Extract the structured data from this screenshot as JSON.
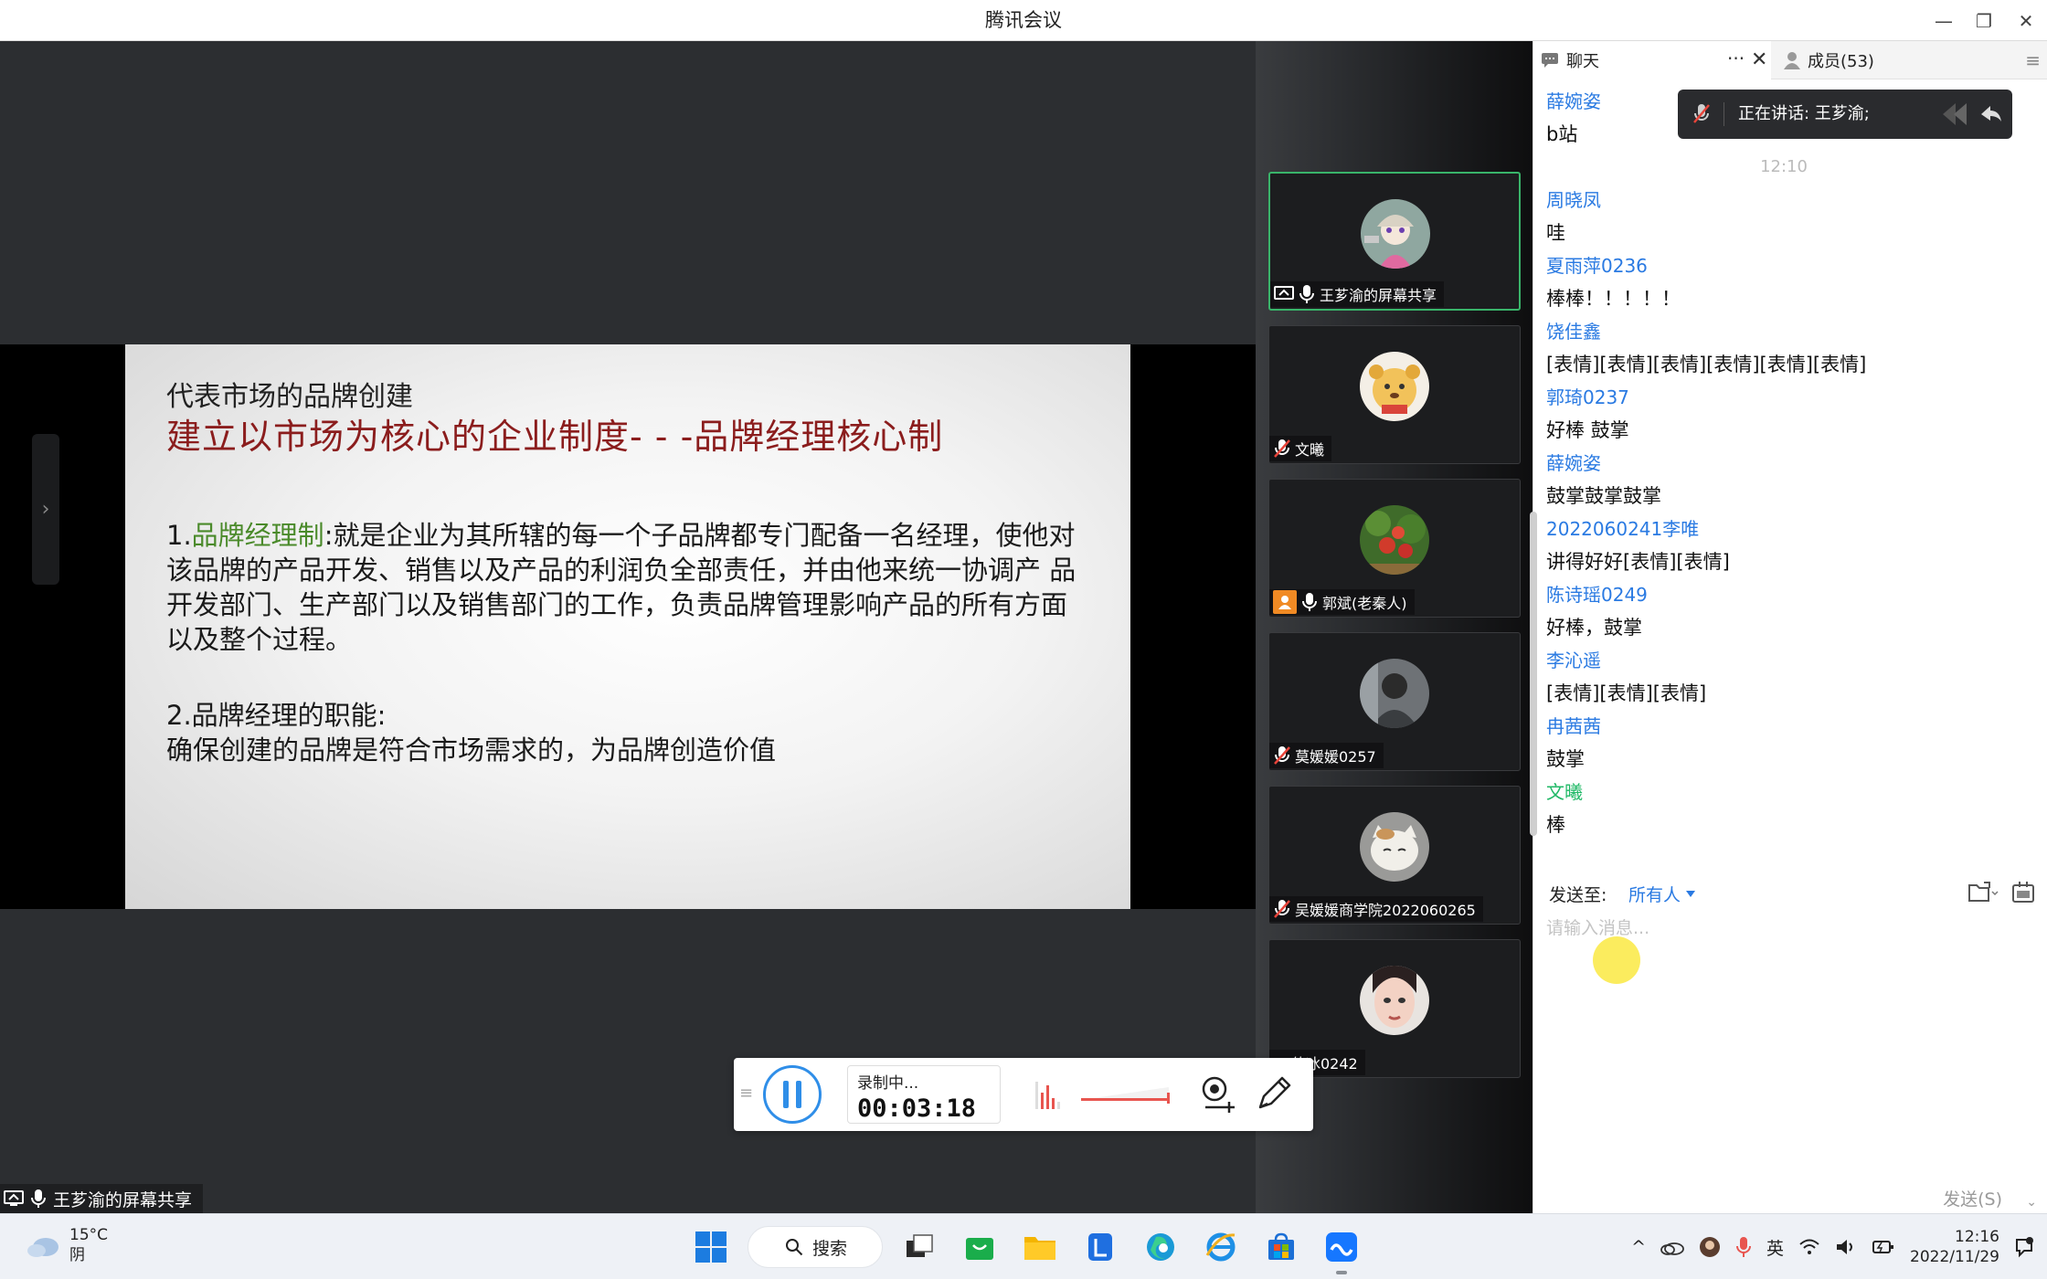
{
  "window": {
    "title": "腾讯会议",
    "minimize_glyph": "—",
    "restore_glyph": "❐",
    "close_glyph": "✕"
  },
  "share": {
    "presenter_label": "王芗渝的屏幕共享"
  },
  "slide": {
    "title": "代表市场的品牌创建",
    "headline": "建立以市场为核心的企业制度- - -品牌经理核心制",
    "point1_prefix": "1.",
    "point1_term": "品牌经理制",
    "point1_body": ":就是企业为其所辖的每一个子品牌都专门配备一名经理，使他对该品牌的产品开发、销售以及产品的利润负全部责任，并由他来统一协调产 品开发部门、生产部门以及销售部门的工作，负责品牌管理影响产品的所有方面以及整个过程。",
    "point2_title": "2.品牌经理的职能:",
    "point2_body": "确保创建的品牌是符合市场需求的，为品牌创造价值",
    "headline_color": "#8b1d1d",
    "term_color": "#4a8a2a"
  },
  "gallery": [
    {
      "name": "王芗渝的屏幕共享",
      "mic": "on",
      "sharing": true,
      "host": false,
      "active": true,
      "avatar": "anime-avatar"
    },
    {
      "name": "文曦",
      "mic": "muted",
      "sharing": false,
      "host": false,
      "active": false,
      "avatar": "bear-avatar"
    },
    {
      "name": "郭斌(老秦人)",
      "mic": "on",
      "sharing": false,
      "host": true,
      "active": false,
      "avatar": "apple-tree-avatar"
    },
    {
      "name": "莫媛媛0257",
      "mic": "muted",
      "sharing": false,
      "host": false,
      "active": false,
      "avatar": "person-avatar"
    },
    {
      "name": "吴媛媛商学院2022060265",
      "mic": "muted",
      "sharing": false,
      "host": false,
      "active": false,
      "avatar": "cat-avatar"
    },
    {
      "name": "倚冰0242",
      "mic": "none",
      "sharing": false,
      "host": false,
      "active": false,
      "avatar": "face-avatar"
    }
  ],
  "recording": {
    "status": "录制中...",
    "elapsed": "00:03:18"
  },
  "chat_panel": {
    "tab_chat": "聊天",
    "tab_more": "···",
    "tab_close": "✕",
    "tab_members": "成员(53)",
    "tab_menu": "≡",
    "speaking_toast": "正在讲话: 王芗渝;",
    "messages": [
      {
        "name": "薛婉姿",
        "text": "b站",
        "name_color": "#2a7ae2"
      },
      {
        "separator": "12:10"
      },
      {
        "name": "周晓凤",
        "text": "哇",
        "name_color": "#2a7ae2"
      },
      {
        "name": "夏雨萍0236",
        "text": "棒棒！！！！！",
        "name_color": "#2a7ae2"
      },
      {
        "name": "饶佳鑫",
        "text": "[表情][表情][表情][表情][表情][表情]",
        "name_color": "#2a7ae2"
      },
      {
        "name": "郭琦0237",
        "text": "好棒 鼓掌",
        "name_color": "#2a7ae2"
      },
      {
        "name": "薛婉姿",
        "text": "鼓掌鼓掌鼓掌",
        "name_color": "#2a7ae2"
      },
      {
        "name": "2022060241李唯",
        "text": "讲得好好[表情][表情]",
        "name_color": "#2a7ae2"
      },
      {
        "name": "陈诗瑶0249",
        "text": "好棒，鼓掌",
        "name_color": "#2a7ae2"
      },
      {
        "name": "李沁遥",
        "text": "[表情][表情][表情]",
        "name_color": "#2a7ae2"
      },
      {
        "name": "冉茜茜",
        "text": "鼓掌",
        "name_color": "#2a7ae2"
      },
      {
        "name": "文曦",
        "text": "棒",
        "name_color": "#1fb866"
      }
    ],
    "send_to_label": "发送至:",
    "recipient": "所有人",
    "input_placeholder": "请输入消息...",
    "send_button": "发送(S)"
  },
  "taskbar": {
    "weather_temp": "15°C",
    "weather_desc": "阴",
    "search_label": "搜索",
    "ime": "英",
    "time": "12:16",
    "date": "2022/11/29"
  }
}
